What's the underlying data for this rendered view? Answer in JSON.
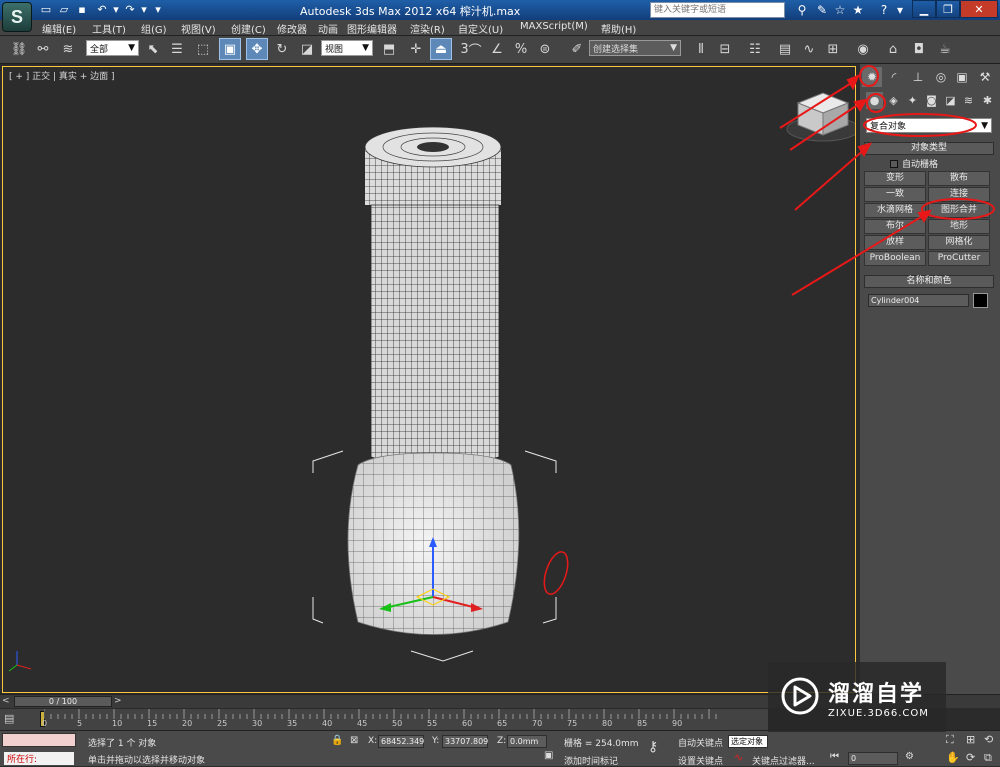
{
  "titlebar": {
    "title": "Autodesk 3ds Max  2012 x64    榨汁机.max",
    "search_placeholder": "键入关键字或短语",
    "app_logo": "S"
  },
  "menu": [
    "编辑(E)",
    "工具(T)",
    "组(G)",
    "视图(V)",
    "创建(C)",
    "修改器",
    "动画",
    "图形编辑器",
    "渲染(R)",
    "自定义(U)",
    "MAXScript(M)",
    "帮助(H)"
  ],
  "toolbar": {
    "selection_filter": "全部",
    "reference_coord": "视图",
    "snap_3": "3",
    "angle_snap_label": "%",
    "named_selection_placeholder": "创建选择集"
  },
  "viewport": {
    "label": "[ + ] 正交 | 真实 + 边面 ]"
  },
  "command_panel": {
    "category": "复合对象",
    "object_type_title": "对象类型",
    "auto_grid": "自动栅格",
    "buttons": [
      "变形",
      "散布",
      "一致",
      "连接",
      "水滴网格",
      "图形合并",
      "布尔",
      "地形",
      "放样",
      "网格化",
      "ProBoolean",
      "ProCutter"
    ],
    "name_color_title": "名称和颜色",
    "object_name": "Cylinder004"
  },
  "timeline": {
    "frame_counter": "0 / 100",
    "ticks": [
      "0",
      "5",
      "10",
      "15",
      "20",
      "25",
      "30",
      "35",
      "40",
      "45",
      "50",
      "55",
      "60",
      "65",
      "70",
      "75",
      "80",
      "85",
      "90"
    ]
  },
  "status": {
    "running_label": "所在行:",
    "selection_info": "选择了 1 个 对象",
    "prompt": "单击并拖动以选择并移动对象",
    "x_label": "X:",
    "x_value": "68452.349",
    "y_label": "Y:",
    "y_value": "33707.809",
    "z_label": "Z:",
    "z_value": "0.0mm",
    "grid": "栅格 = 254.0mm",
    "add_time_tag": "添加时间标记",
    "auto_key": "自动关键点",
    "selected_object": "选定对象",
    "set_key": "设置关键点",
    "key_filters": "关键点过滤器...",
    "frame_value": "0"
  },
  "watermark": {
    "brand": "溜溜自学",
    "url": "ZIXUE.3D66.COM"
  },
  "colors": {
    "annotation_red": "#e81818",
    "viewport_border": "#ffc83c",
    "titlebar": "#1f5fa8"
  }
}
